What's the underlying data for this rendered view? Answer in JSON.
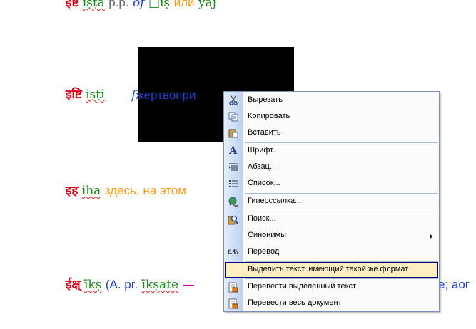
{
  "document": {
    "line0": {
      "deva": "इष्ट",
      "translit": "iṣṭa",
      "rest1": "p.p.",
      "rest2": "of",
      "rest3": "□iṣ",
      "rest4": "или",
      "rest5": "yaj"
    },
    "line1": {
      "deva": "इष्टि",
      "translit": "iṣṭi",
      "f": "f",
      "text": "жертвопри"
    },
    "line2": {
      "deva": "इह",
      "translit": "iha",
      "text": "здесь, на этом"
    },
    "line3": {
      "deva": "ईक्ष्",
      "translit": "īkṣ",
      "paren": "(",
      "ap": "A. pr.",
      "translit2": "īkṣate",
      "dash": "—",
      "tail": "e; aor"
    }
  },
  "context_menu": {
    "items": [
      {
        "label": "Вырезать",
        "icon": "scissors-icon"
      },
      {
        "label": "Копировать",
        "icon": "copy-icon"
      },
      {
        "label": "Вставить",
        "icon": "paste-icon"
      },
      {
        "label": "Шрифт...",
        "icon": "font-icon"
      },
      {
        "label": "Абзац...",
        "icon": "paragraph-icon"
      },
      {
        "label": "Список...",
        "icon": "list-icon"
      },
      {
        "label": "Гиперссылка...",
        "icon": "hyperlink-icon"
      },
      {
        "label": "Поиск...",
        "icon": "search-icon"
      },
      {
        "label": "Синонимы",
        "icon": "",
        "submenu": true
      },
      {
        "label": "Перевод",
        "icon": "translate-icon"
      },
      {
        "label": "Выделить текст, имеющий такой же формат",
        "icon": "",
        "highlighted": true
      },
      {
        "label": "Перевести выделенный текст",
        "icon": "translate-selection-icon"
      },
      {
        "label": "Перевести весь документ",
        "icon": "translate-document-icon"
      }
    ]
  },
  "colors": {
    "devanagari": "#e0001a",
    "transliteration": "#1a8a1a",
    "russian_blue": "#1f3fd0",
    "russian_orange": "#ff9a1e",
    "menu_border": "#7b90b6",
    "menu_highlight": "#ffeec2",
    "menu_highlight_border": "#000080"
  }
}
